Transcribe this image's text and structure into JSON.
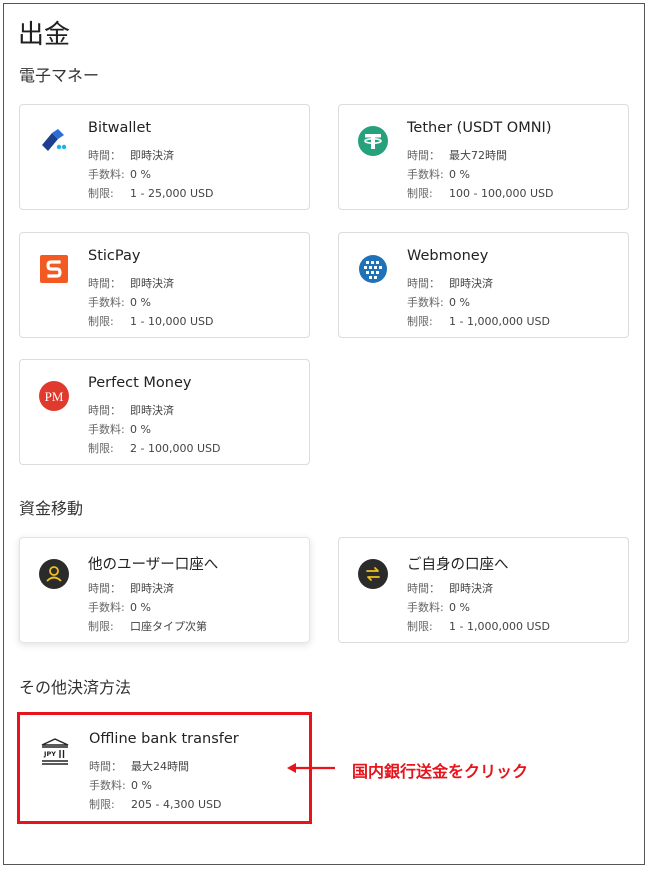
{
  "page": {
    "title": "出金"
  },
  "colors": {
    "accent_red": "#e8141b",
    "tether_green": "#26a17b",
    "sticpay_orange": "#f25a22",
    "pm_red": "#e03a2e",
    "webmoney_blue": "#1f72b8",
    "dark_icon": "#2b2b2b",
    "gold": "#f0c020"
  },
  "sections": [
    {
      "title": "電子マネー"
    },
    {
      "title": "資金移動"
    },
    {
      "title": "その他決済方法"
    }
  ],
  "labels": {
    "time": "時間：",
    "fee": "手数料:",
    "limit": "制限:"
  },
  "methods": [
    {
      "name": "Bitwallet",
      "icon": "bitwallet-icon",
      "time": "即時決済",
      "fee": "0 %",
      "limit": "1 - 25,000 USD"
    },
    {
      "name": "Tether (USDT OMNI)",
      "icon": "tether-icon",
      "time": "最大72時間",
      "fee": "0 %",
      "limit": "100 - 100,000 USD"
    },
    {
      "name": "SticPay",
      "icon": "sticpay-icon",
      "time": "即時決済",
      "fee": "0 %",
      "limit": "1 - 10,000 USD"
    },
    {
      "name": "Webmoney",
      "icon": "webmoney-icon",
      "time": "即時決済",
      "fee": "0 %",
      "limit": "1 - 1,000,000 USD"
    },
    {
      "name": "Perfect Money",
      "icon": "perfect-money-icon",
      "icon_text": "PM",
      "time": "即時決済",
      "fee": "0 %",
      "limit": "2 - 100,000 USD"
    },
    {
      "name": "他のユーザー口座へ",
      "icon": "user-icon",
      "time": "即時決済",
      "fee": "0 %",
      "limit": "口座タイプ次第"
    },
    {
      "name": "ご自身の口座へ",
      "icon": "transfer-arrows-icon",
      "time": "即時決済",
      "fee": "0 %",
      "limit": "1 - 1,000,000 USD"
    },
    {
      "name": "Offline bank transfer",
      "icon": "bank-icon",
      "icon_text": "JPY",
      "time": "最大24時間",
      "fee": "0 %",
      "limit": "205 - 4,300 USD"
    }
  ],
  "annotation": {
    "text": "国内銀行送金をクリック"
  }
}
